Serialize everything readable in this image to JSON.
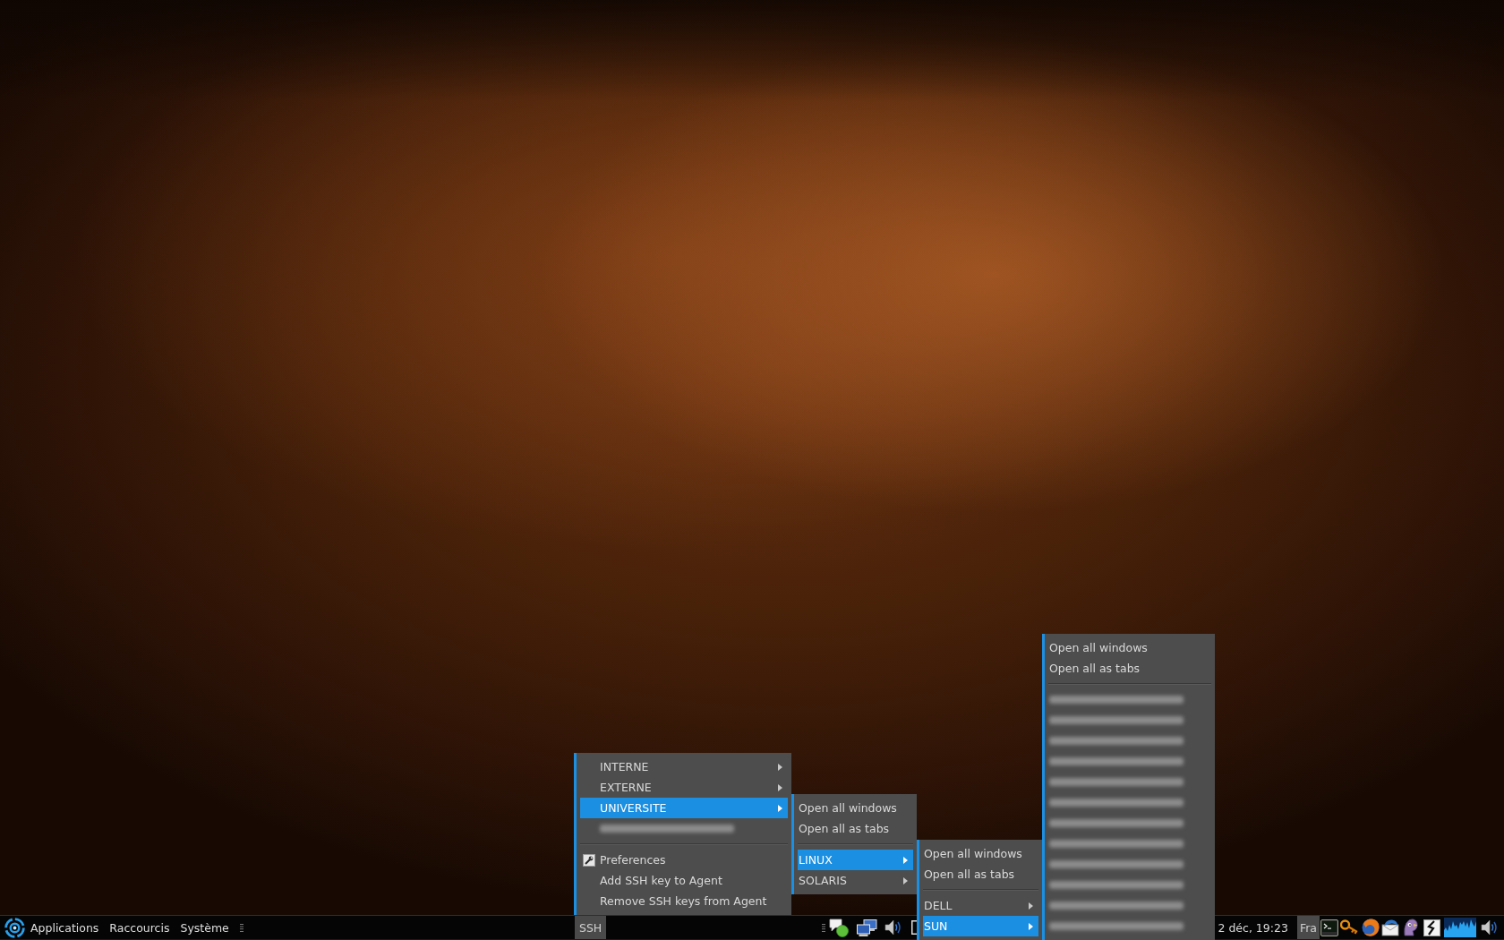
{
  "panel": {
    "main_menus": [
      "Applications",
      "Raccourcis",
      "Système"
    ],
    "ssh_applet": {
      "label": "SSH",
      "active": true
    },
    "clock": "2 déc, 19:23",
    "keyboard_layout": "Fra"
  },
  "ssh_menu": {
    "items": [
      {
        "kind": "submenu",
        "label": "INTERNE",
        "selected": false
      },
      {
        "kind": "submenu",
        "label": "EXTERNE",
        "selected": false
      },
      {
        "kind": "submenu",
        "label": "UNIVERSITE",
        "selected": true,
        "children": [
          {
            "kind": "action",
            "label": "Open all windows",
            "selected": false
          },
          {
            "kind": "action",
            "label": "Open all as tabs",
            "selected": false
          },
          {
            "kind": "separator"
          },
          {
            "kind": "submenu",
            "label": "LINUX",
            "selected": true,
            "children": [
              {
                "kind": "action",
                "label": "Open all windows",
                "selected": false
              },
              {
                "kind": "action",
                "label": "Open all as tabs",
                "selected": false
              },
              {
                "kind": "separator"
              },
              {
                "kind": "submenu",
                "label": "DELL",
                "selected": false
              },
              {
                "kind": "submenu",
                "label": "SUN",
                "selected": true,
                "children": [
                  {
                    "kind": "action",
                    "label": "Open all windows",
                    "selected": false
                  },
                  {
                    "kind": "action",
                    "label": "Open all as tabs",
                    "selected": false
                  },
                  {
                    "kind": "separator"
                  },
                  {
                    "kind": "redacted"
                  },
                  {
                    "kind": "redacted"
                  },
                  {
                    "kind": "redacted"
                  },
                  {
                    "kind": "redacted"
                  },
                  {
                    "kind": "redacted"
                  },
                  {
                    "kind": "redacted"
                  },
                  {
                    "kind": "redacted"
                  },
                  {
                    "kind": "redacted"
                  },
                  {
                    "kind": "redacted"
                  },
                  {
                    "kind": "redacted"
                  },
                  {
                    "kind": "redacted"
                  },
                  {
                    "kind": "redacted"
                  }
                ]
              }
            ]
          },
          {
            "kind": "submenu",
            "label": "SOLARIS",
            "selected": false
          }
        ]
      },
      {
        "kind": "redacted"
      },
      {
        "kind": "separator"
      },
      {
        "kind": "setting",
        "label": "Preferences",
        "selected": false
      },
      {
        "kind": "action",
        "label": "Add SSH key to Agent",
        "selected": false
      },
      {
        "kind": "action",
        "label": "Remove SSH keys from Agent",
        "selected": false
      }
    ]
  }
}
